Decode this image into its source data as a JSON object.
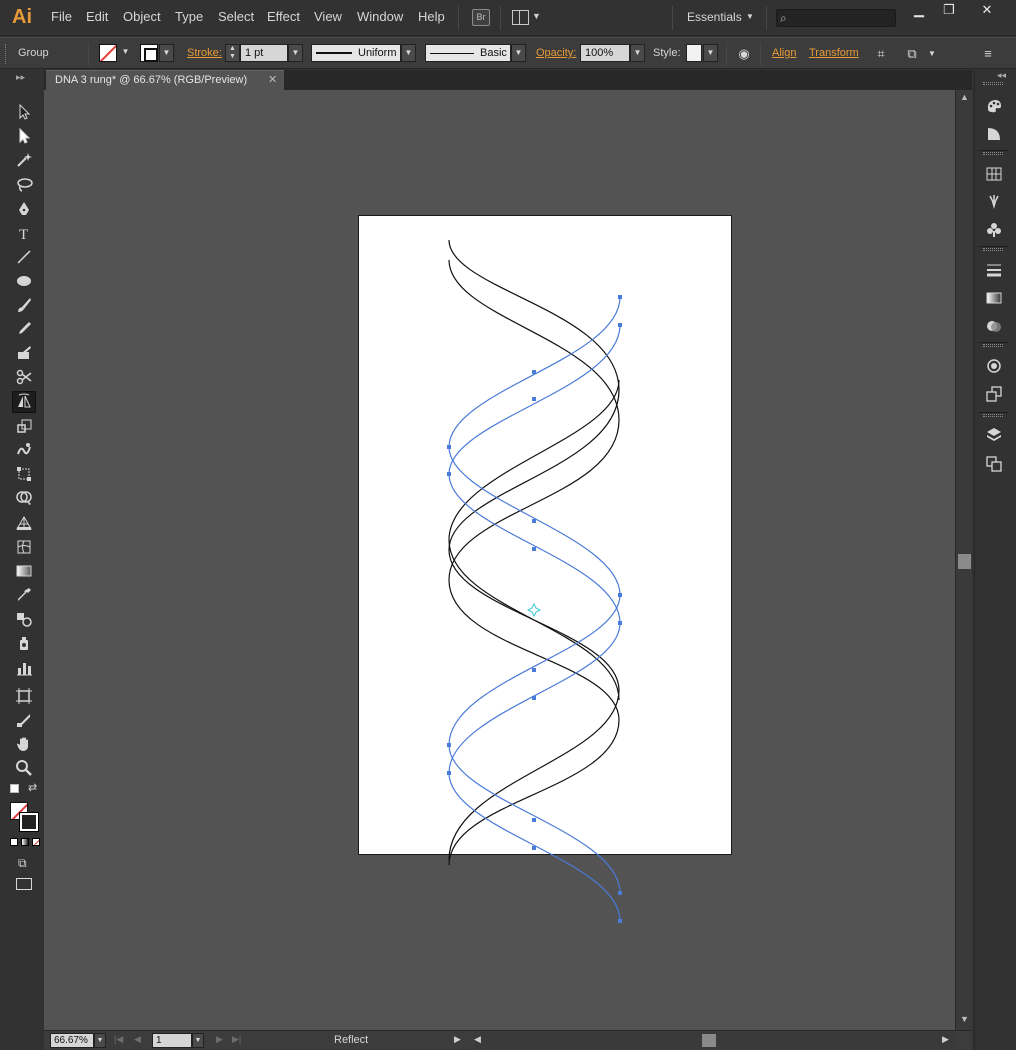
{
  "app": {
    "logo": "Ai",
    "menu": [
      "File",
      "Edit",
      "Object",
      "Type",
      "Select",
      "Effect",
      "View",
      "Window",
      "Help"
    ],
    "bridge_label": "Br",
    "workspace": "Essentials",
    "window_controls": {
      "minimize": "▁",
      "restore": "❐",
      "close": "✕"
    }
  },
  "control_bar": {
    "selection_type": "Group",
    "stroke_label": "Stroke:",
    "stroke_weight": "1 pt",
    "profile": "Uniform",
    "brush": "Basic",
    "opacity_label": "Opacity:",
    "opacity": "100%",
    "style_label": "Style:",
    "align_label": "Align",
    "transform_label": "Transform"
  },
  "document": {
    "tab_title": "DNA 3 rung* @ 66.67% (RGB/Preview)",
    "close_glyph": "✕"
  },
  "status_bar": {
    "zoom": "66.67%",
    "page": "1",
    "current_tool": "Reflect"
  },
  "colors": {
    "accent": "#e79b38",
    "selection": "#4a7bd8",
    "canvas": "#535353",
    "artboard": "#ffffff"
  },
  "tools": [
    "selection-icon",
    "direct-selection-icon",
    "magic-wand-icon",
    "lasso-icon",
    "pen-icon",
    "type-icon",
    "line-segment-icon",
    "ellipse-icon",
    "paintbrush-icon",
    "pencil-icon",
    "blob-brush-icon",
    "scissors-icon",
    "reflect-icon",
    "scale-icon",
    "warp-icon",
    "free-transform-icon",
    "shape-builder-icon",
    "perspective-grid-icon",
    "mesh-icon",
    "gradient-icon",
    "eyedropper-icon",
    "blend-icon",
    "symbol-sprayer-icon",
    "column-graph-icon",
    "artboard-icon",
    "slice-icon",
    "hand-icon",
    "zoom-icon"
  ],
  "dock_icons": [
    "color-icon",
    "color-guide-icon",
    "swatches-icon",
    "brushes-icon",
    "symbols-icon",
    "stroke-icon",
    "gradient-panel-icon",
    "transparency-icon",
    "appearance-icon",
    "graphic-styles-icon",
    "layers-icon",
    "artboards-icon"
  ]
}
